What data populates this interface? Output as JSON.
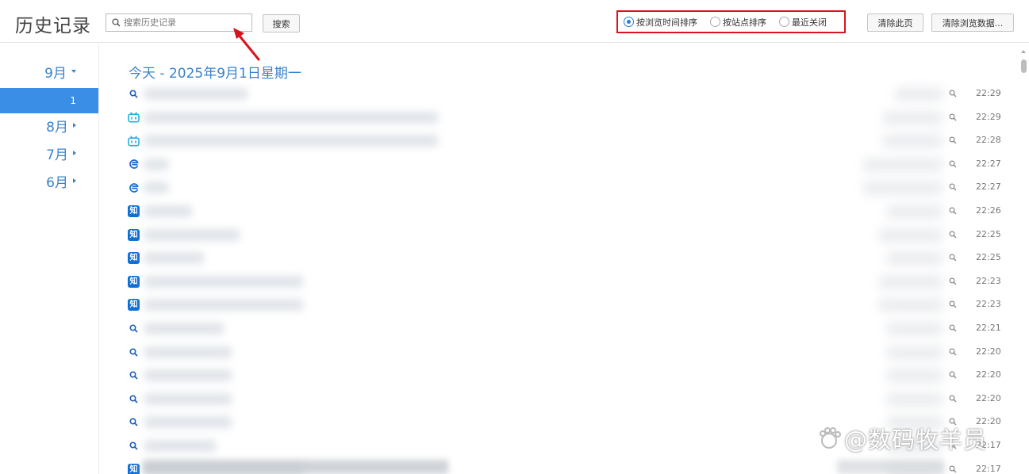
{
  "header": {
    "title": "历史记录",
    "search_placeholder": "搜索历史记录",
    "search_button": "搜索",
    "sort_options": [
      {
        "label": "按浏览时间排序",
        "selected": true
      },
      {
        "label": "按站点排序",
        "selected": false
      },
      {
        "label": "最近关闭",
        "selected": false
      }
    ],
    "clear_page_button": "清除此页",
    "clear_data_button": "清除浏览数据..."
  },
  "sidebar": {
    "months": [
      {
        "label": "9月",
        "expanded": true
      },
      {
        "label": "8月",
        "expanded": false
      },
      {
        "label": "7月",
        "expanded": false
      },
      {
        "label": "6月",
        "expanded": false
      }
    ],
    "selected_day": "1"
  },
  "main": {
    "date_heading": "今天 - 2025年9月1日星期一",
    "entries": [
      {
        "icon": "search-icon",
        "time": "22:29"
      },
      {
        "icon": "bilibili-icon",
        "time": "22:29"
      },
      {
        "icon": "bilibili-icon",
        "time": "22:28"
      },
      {
        "icon": "edge-icon",
        "time": "22:27"
      },
      {
        "icon": "edge-icon",
        "time": "22:27"
      },
      {
        "icon": "zhihu-icon",
        "time": "22:26"
      },
      {
        "icon": "zhihu-icon",
        "time": "22:25"
      },
      {
        "icon": "zhihu-icon",
        "time": "22:25"
      },
      {
        "icon": "zhihu-icon",
        "time": "22:23"
      },
      {
        "icon": "zhihu-icon",
        "time": "22:23"
      },
      {
        "icon": "search-icon",
        "time": "22:21"
      },
      {
        "icon": "search-icon",
        "time": "22:20"
      },
      {
        "icon": "search-icon",
        "time": "22:20"
      },
      {
        "icon": "search-icon",
        "time": "22:20"
      },
      {
        "icon": "search-icon",
        "time": "22:20"
      },
      {
        "icon": "search-icon",
        "time": "22:17"
      },
      {
        "icon": "zhihu-icon",
        "time": "22:17"
      }
    ],
    "zhihu_glyph": "知"
  },
  "watermark": {
    "text": "@数码牧羊员"
  },
  "colors": {
    "accent": "#3a82cc",
    "selected_day_bg": "#3a8ee6",
    "highlight_border": "#d9141c",
    "bilibili": "#23ade5",
    "zhihu": "#0f6fd6"
  }
}
